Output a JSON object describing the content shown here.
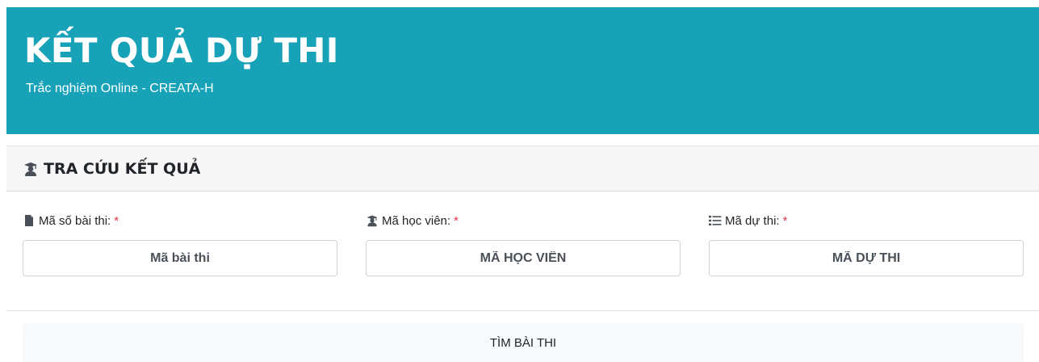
{
  "header": {
    "title": "KẾT QUẢ DỰ THI",
    "subtitle": "Trắc nghiệm Online - CREATA-H",
    "bg_color": "#17a2b8"
  },
  "lookup": {
    "title": "TRA CỨU KẾT QUẢ",
    "icon": "graduate-icon"
  },
  "fields": [
    {
      "icon": "file-icon",
      "label": "Mã số bài thi:",
      "required_mark": "*",
      "placeholder": "Mã bài thi"
    },
    {
      "icon": "graduate-icon",
      "label": "Mã học viên:",
      "required_mark": "*",
      "placeholder": "MÃ HỌC VIÊN"
    },
    {
      "icon": "list-icon",
      "label": "Mã dự thi:",
      "required_mark": "*",
      "placeholder": "MÃ DỰ THI"
    }
  ],
  "actions": {
    "submit_label": "TÌM BÀI THI"
  },
  "colors": {
    "accent": "#17a2b8",
    "required": "#dc3545"
  }
}
